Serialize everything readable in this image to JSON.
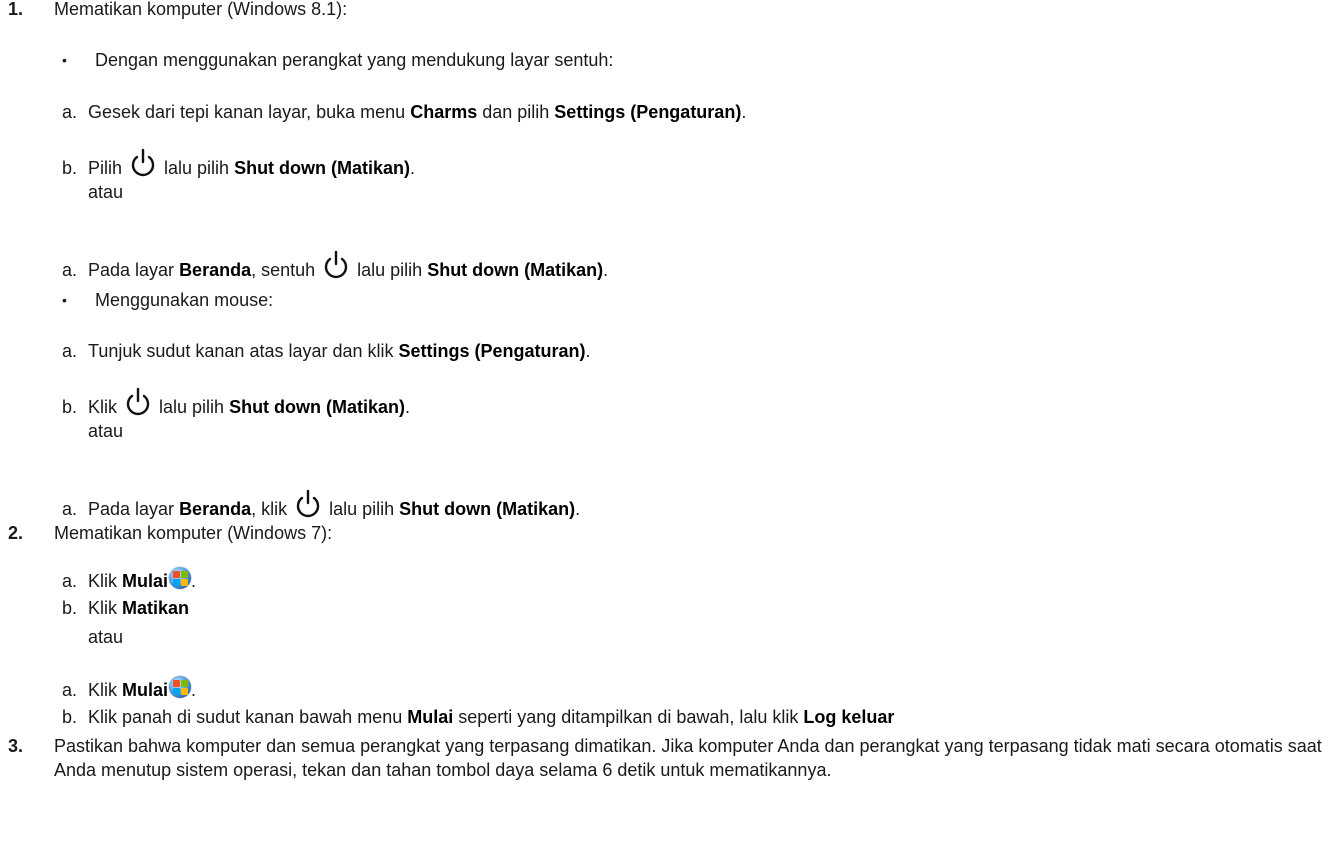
{
  "steps": {
    "s1": {
      "num": "1.",
      "title": "Mematikan komputer (Windows 8.1):",
      "touch_bullet": "Dengan menggunakan perangkat yang mendukung layar sentuh:",
      "t_a_letter": "a.",
      "t_a_1": "Gesek dari tepi kanan layar, buka menu ",
      "t_a_b1": "Charms",
      "t_a_2": " dan pilih ",
      "t_a_b2": "Settings (Pengaturan)",
      "t_a_3": ".",
      "t_b_letter": "b.",
      "t_b_1": "Pilih",
      "t_b_2": "lalu pilih ",
      "t_b_b1": "Shut down (Matikan)",
      "t_b_3": ".",
      "t_or": "atau",
      "t_a2_letter": "a.",
      "t_a2_1": "Pada layar ",
      "t_a2_b1": "Beranda",
      "t_a2_2": ", sentuh",
      "t_a2_3": "lalu pilih ",
      "t_a2_b2": "Shut down (Matikan)",
      "t_a2_4": ".",
      "mouse_bullet": "Menggunakan mouse:",
      "m_a_letter": "a.",
      "m_a_1": "Tunjuk sudut kanan atas layar dan klik ",
      "m_a_b1": "Settings (Pengaturan)",
      "m_a_2": ".",
      "m_b_letter": "b.",
      "m_b_1": "Klik",
      "m_b_2": "lalu pilih ",
      "m_b_b1": "Shut down (Matikan)",
      "m_b_3": ".",
      "m_or": "atau",
      "m_a2_letter": "a.",
      "m_a2_1": "Pada layar ",
      "m_a2_b1": "Beranda",
      "m_a2_2": ", klik",
      "m_a2_3": "lalu pilih ",
      "m_a2_b2": "Shut down (Matikan)",
      "m_a2_4": "."
    },
    "s2": {
      "num": "2.",
      "title": "Mematikan komputer (Windows 7):",
      "a_letter": "a.",
      "a_1": "Klik ",
      "a_b1": "Mulai",
      "a_2": ".",
      "b_letter": "b.",
      "b_1": "Klik ",
      "b_b1": "Matikan",
      "or": "atau",
      "a2_letter": "a.",
      "a2_1": "Klik ",
      "a2_b1": "Mulai",
      "a2_2": ".",
      "b2_letter": "b.",
      "b2_1": "Klik panah di sudut kanan bawah menu ",
      "b2_b1": "Mulai",
      "b2_2": " seperti yang ditampilkan di bawah, lalu klik ",
      "b2_b2": "Log keluar"
    },
    "s3": {
      "num": "3.",
      "text": "Pastikan bahwa komputer dan semua perangkat yang terpasang dimatikan. Jika komputer Anda dan perangkat yang terpasang tidak mati secara otomatis saat Anda menutup sistem operasi, tekan dan tahan tombol daya selama 6 detik untuk mematikannya."
    }
  },
  "icons": {
    "power": "power-icon",
    "windows_start": "windows-start-orb-icon"
  }
}
